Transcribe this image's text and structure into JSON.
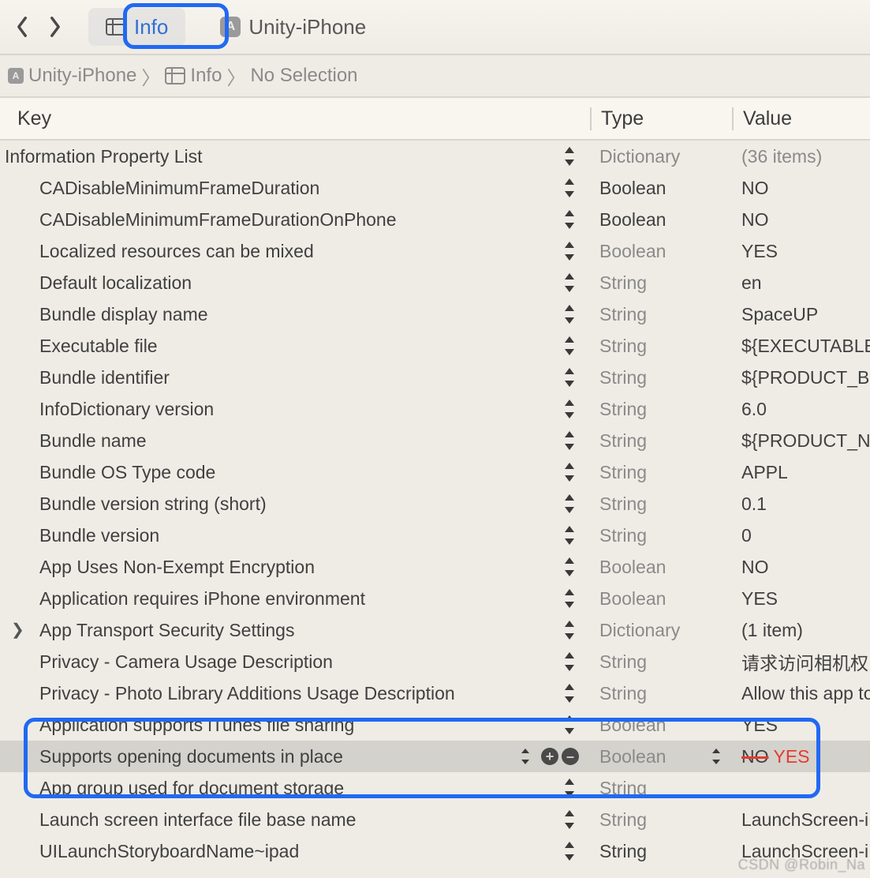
{
  "tabs": {
    "info": "Info",
    "project": "Unity-iPhone"
  },
  "breadcrumb": {
    "project": "Unity-iPhone",
    "file": "Info",
    "selection": "No Selection"
  },
  "columns": {
    "key": "Key",
    "type": "Type",
    "value": "Value"
  },
  "root": {
    "key": "Information Property List",
    "type": "Dictionary",
    "value": "(36 items)"
  },
  "rows": [
    {
      "key": "CADisableMinimumFrameDuration",
      "type": "Boolean",
      "value": "NO",
      "type_em": true
    },
    {
      "key": "CADisableMinimumFrameDurationOnPhone",
      "type": "Boolean",
      "value": "NO",
      "type_em": true
    },
    {
      "key": "Localized resources can be mixed",
      "type": "Boolean",
      "value": "YES"
    },
    {
      "key": "Default localization",
      "type": "String",
      "value": "en"
    },
    {
      "key": "Bundle display name",
      "type": "String",
      "value": "SpaceUP"
    },
    {
      "key": "Executable file",
      "type": "String",
      "value": "${EXECUTABLE"
    },
    {
      "key": "Bundle identifier",
      "type": "String",
      "value": "${PRODUCT_B"
    },
    {
      "key": "InfoDictionary version",
      "type": "String",
      "value": "6.0"
    },
    {
      "key": "Bundle name",
      "type": "String",
      "value": "${PRODUCT_N"
    },
    {
      "key": "Bundle OS Type code",
      "type": "String",
      "value": "APPL"
    },
    {
      "key": "Bundle version string (short)",
      "type": "String",
      "value": "0.1"
    },
    {
      "key": "Bundle version",
      "type": "String",
      "value": "0"
    },
    {
      "key": "App Uses Non-Exempt Encryption",
      "type": "Boolean",
      "value": "NO"
    },
    {
      "key": "Application requires iPhone environment",
      "type": "Boolean",
      "value": "YES"
    },
    {
      "key": "App Transport Security Settings",
      "type": "Dictionary",
      "value": "(1 item)",
      "disclosure": true
    },
    {
      "key": "Privacy - Camera Usage Description",
      "type": "String",
      "value": "请求访问相机权限"
    },
    {
      "key": "Privacy - Photo Library Additions Usage Description",
      "type": "String",
      "value": "Allow this app to"
    },
    {
      "key": "Application supports iTunes file sharing",
      "type": "Boolean",
      "value": "YES"
    },
    {
      "key": "Supports opening documents in place",
      "type": "Boolean",
      "value_strike": "NO",
      "value_new": "YES",
      "selected": true,
      "inline_controls": true
    },
    {
      "key": "App group used for document storage",
      "type": "String",
      "value": ""
    },
    {
      "key": "Launch screen interface file base name",
      "type": "String",
      "value": "LaunchScreen-iPh"
    },
    {
      "key": "UILaunchStoryboardName~ipad",
      "type": "String",
      "value": "LaunchScreen-iPa",
      "type_em": true
    }
  ],
  "watermark": "CSDN @Robin_Na"
}
